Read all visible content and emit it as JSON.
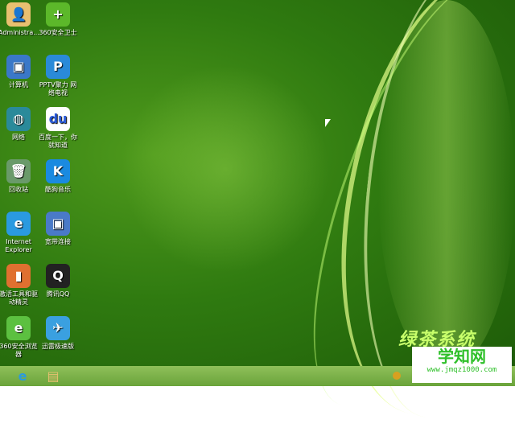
{
  "desktop_icons": [
    {
      "label": "Administra...",
      "glyph": "👤",
      "color": "#e8c070"
    },
    {
      "label": "360安全卫士",
      "glyph": "+",
      "color": "#5cb82a"
    },
    {
      "label": "计算机",
      "glyph": "▣",
      "color": "#3a78c8"
    },
    {
      "label": "PPTV聚力 网络电视",
      "glyph": "P",
      "color": "#2a8ad8"
    },
    {
      "label": "网络",
      "glyph": "◍",
      "color": "#2a8a9a"
    },
    {
      "label": "百度一下，你就知道",
      "glyph": "du",
      "color": "#ffffff"
    },
    {
      "label": "回收站",
      "glyph": "🗑",
      "color": "#6a9a6a"
    },
    {
      "label": "酷狗音乐",
      "glyph": "K",
      "color": "#1a8ae0"
    },
    {
      "label": "Internet Explorer",
      "glyph": "e",
      "color": "#2a9ae0"
    },
    {
      "label": "宽带连接",
      "glyph": "▣",
      "color": "#4a7ac8"
    },
    {
      "label": "激活工具和驱动精灵",
      "glyph": "▮",
      "color": "#e07030"
    },
    {
      "label": "腾讯QQ",
      "glyph": "Q",
      "color": "#222222"
    },
    {
      "label": "360安全浏览器",
      "glyph": "e",
      "color": "#5cc040"
    },
    {
      "label": "迅雷极速版",
      "glyph": "✈",
      "color": "#3aa0e0"
    }
  ],
  "wallpaper_text": "绿茶系统",
  "watermark": {
    "title": "学知网",
    "url": "www.jmqz1000.com"
  },
  "taskbar": {
    "items": [
      {
        "name": "internet-explorer",
        "glyph": "e"
      },
      {
        "name": "file-explorer",
        "glyph": "▤"
      }
    ]
  }
}
